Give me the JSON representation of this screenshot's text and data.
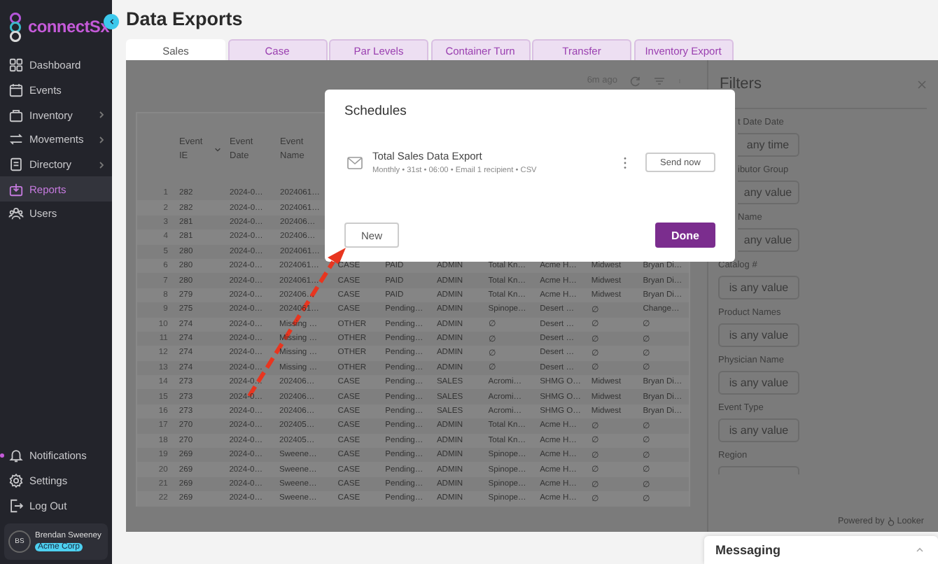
{
  "sidebar": {
    "logo": "connectSx",
    "items": [
      {
        "label": "Dashboard",
        "selected": false,
        "has_submenu": false
      },
      {
        "label": "Events",
        "selected": false,
        "has_submenu": false
      },
      {
        "label": "Inventory",
        "selected": false,
        "has_submenu": true
      },
      {
        "label": "Movements",
        "selected": false,
        "has_submenu": true
      },
      {
        "label": "Directory",
        "selected": false,
        "has_submenu": true
      },
      {
        "label": "Reports",
        "selected": true,
        "has_submenu": false
      },
      {
        "label": "Users",
        "selected": false,
        "has_submenu": false
      }
    ],
    "bottom_items": [
      {
        "label": "Notifications",
        "unread": true
      },
      {
        "label": "Settings",
        "unread": false
      },
      {
        "label": "Log Out",
        "unread": false
      }
    ],
    "user": {
      "initials": "BS",
      "name": "Brendan Sweeney",
      "org": "Acme Corp"
    }
  },
  "page_title": "Data Exports",
  "tabs": [
    {
      "label": "Sales",
      "selected": true
    },
    {
      "label": "Case",
      "selected": false
    },
    {
      "label": "Par Levels",
      "selected": false
    },
    {
      "label": "Container Turn",
      "selected": false
    },
    {
      "label": "Transfer",
      "selected": false
    },
    {
      "label": "Inventory Export",
      "selected": false
    }
  ],
  "report": {
    "updated": "6m ago",
    "table": {
      "columns": [
        "Event IE",
        "Event Date",
        "Event Name"
      ],
      "rows": [
        {
          "n": "1",
          "cells": [
            "282",
            "2024-0…",
            "2024061…"
          ]
        },
        {
          "n": "2",
          "cells": [
            "282",
            "2024-0…",
            "2024061…"
          ]
        },
        {
          "n": "3",
          "cells": [
            "281",
            "2024-0…",
            "202406…"
          ]
        },
        {
          "n": "4",
          "cells": [
            "281",
            "2024-0…",
            "202406…"
          ]
        },
        {
          "n": "5",
          "cells": [
            "280",
            "2024-0…",
            "2024061…"
          ]
        },
        {
          "n": "6",
          "cells": [
            "280",
            "2024-0…",
            "2024061…",
            "CASE",
            "PAID",
            "ADMIN",
            "Total Kn…",
            "Acme H…",
            "Midwest",
            "Bryan Di…"
          ]
        },
        {
          "n": "7",
          "cells": [
            "280",
            "2024-0…",
            "2024061…",
            "CASE",
            "PAID",
            "ADMIN",
            "Total Kn…",
            "Acme H…",
            "Midwest",
            "Bryan Di…"
          ]
        },
        {
          "n": "8",
          "cells": [
            "279",
            "2024-0…",
            "202406…",
            "CASE",
            "PAID",
            "ADMIN",
            "Total Kn…",
            "Acme H…",
            "Midwest",
            "Bryan Di…"
          ]
        },
        {
          "n": "9",
          "cells": [
            "275",
            "2024-0…",
            "2024061…",
            "CASE",
            "Pending…",
            "ADMIN",
            "Spinope…",
            "Desert …",
            "∅",
            "Change…"
          ]
        },
        {
          "n": "10",
          "cells": [
            "274",
            "2024-0…",
            "Missing …",
            "OTHER",
            "Pending…",
            "ADMIN",
            "∅",
            "Desert …",
            "∅",
            "∅"
          ]
        },
        {
          "n": "11",
          "cells": [
            "274",
            "2024-0…",
            "Missing …",
            "OTHER",
            "Pending…",
            "ADMIN",
            "∅",
            "Desert …",
            "∅",
            "∅"
          ]
        },
        {
          "n": "12",
          "cells": [
            "274",
            "2024-0…",
            "Missing …",
            "OTHER",
            "Pending…",
            "ADMIN",
            "∅",
            "Desert …",
            "∅",
            "∅"
          ]
        },
        {
          "n": "13",
          "cells": [
            "274",
            "2024-0…",
            "Missing …",
            "OTHER",
            "Pending…",
            "ADMIN",
            "∅",
            "Desert …",
            "∅",
            "∅"
          ]
        },
        {
          "n": "14",
          "cells": [
            "273",
            "2024-0…",
            "202406…",
            "CASE",
            "Pending…",
            "SALES",
            "Acromi…",
            "SHMG O…",
            "Midwest",
            "Bryan Di…"
          ]
        },
        {
          "n": "15",
          "cells": [
            "273",
            "2024-0…",
            "202406…",
            "CASE",
            "Pending…",
            "SALES",
            "Acromi…",
            "SHMG O…",
            "Midwest",
            "Bryan Di…"
          ]
        },
        {
          "n": "16",
          "cells": [
            "273",
            "2024-0…",
            "202406…",
            "CASE",
            "Pending…",
            "SALES",
            "Acromi…",
            "SHMG O…",
            "Midwest",
            "Bryan Di…"
          ]
        },
        {
          "n": "17",
          "cells": [
            "270",
            "2024-0…",
            "202405…",
            "CASE",
            "Pending…",
            "ADMIN",
            "Total Kn…",
            "Acme H…",
            "∅",
            "∅"
          ]
        },
        {
          "n": "18",
          "cells": [
            "270",
            "2024-0…",
            "202405…",
            "CASE",
            "Pending…",
            "ADMIN",
            "Total Kn…",
            "Acme H…",
            "∅",
            "∅"
          ]
        },
        {
          "n": "19",
          "cells": [
            "269",
            "2024-0…",
            "Sweene…",
            "CASE",
            "Pending…",
            "ADMIN",
            "Spinope…",
            "Acme H…",
            "∅",
            "∅"
          ]
        },
        {
          "n": "20",
          "cells": [
            "269",
            "2024-0…",
            "Sweene…",
            "CASE",
            "Pending…",
            "ADMIN",
            "Spinope…",
            "Acme H…",
            "∅",
            "∅"
          ]
        },
        {
          "n": "21",
          "cells": [
            "269",
            "2024-0…",
            "Sweene…",
            "CASE",
            "Pending…",
            "ADMIN",
            "Spinope…",
            "Acme H…",
            "∅",
            "∅"
          ]
        },
        {
          "n": "22",
          "cells": [
            "269",
            "2024-0…",
            "Sweene…",
            "CASE",
            "Pending…",
            "ADMIN",
            "Spinope…",
            "Acme H…",
            "∅",
            "∅"
          ]
        }
      ]
    }
  },
  "filters": {
    "title": "Filters",
    "items": [
      {
        "label": "t Date Date",
        "value": "any time"
      },
      {
        "label": "ibutor Group",
        "value": "any value"
      },
      {
        "label": "Name",
        "value": "any value"
      },
      {
        "label": "Catalog #",
        "value": "is any value"
      },
      {
        "label": "Product Names",
        "value": "is any value"
      },
      {
        "label": "Physician Name",
        "value": "is any value"
      },
      {
        "label": "Event Type",
        "value": "is any value"
      },
      {
        "label": "Region",
        "value": ""
      }
    ],
    "powered_by": "Powered by",
    "brand": "Looker"
  },
  "dialog": {
    "title": "Schedules",
    "schedules": [
      {
        "name": "Total Sales Data Export",
        "details": "Monthly • 31st • 06:00 • Email 1 recipient • CSV",
        "action": "Send now"
      }
    ],
    "new_button": "New",
    "done_button": "Done"
  },
  "messaging": {
    "label": "Messaging"
  }
}
